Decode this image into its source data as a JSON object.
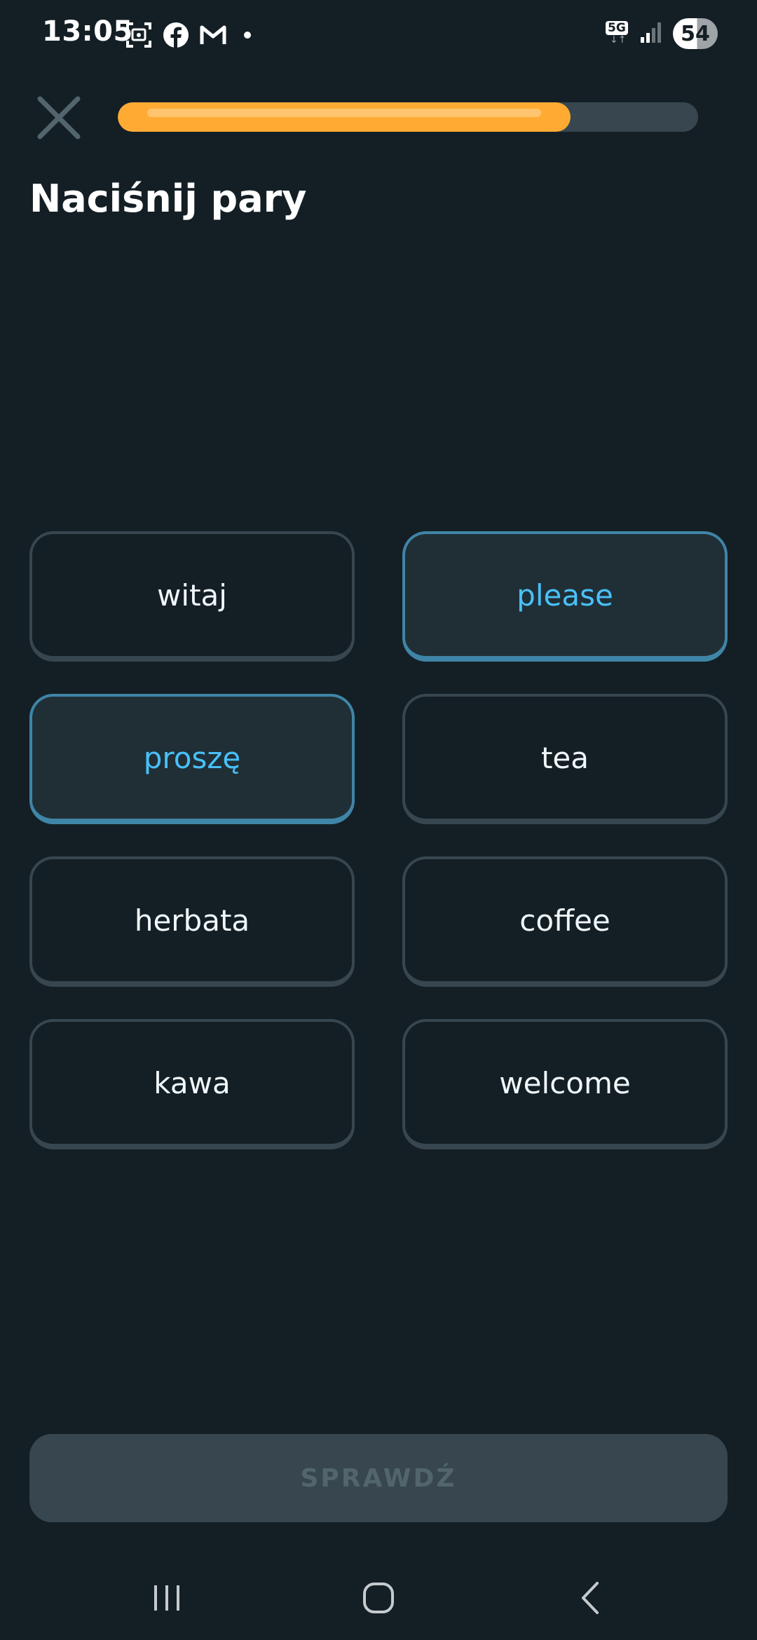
{
  "status_bar": {
    "time": "13:05",
    "network": "5G",
    "battery": "54"
  },
  "header": {
    "progress": 0.78
  },
  "page_title": "Naciśnij pary",
  "tiles": [
    {
      "label": "witaj",
      "selected": false
    },
    {
      "label": "please",
      "selected": true
    },
    {
      "label": "proszę",
      "selected": true
    },
    {
      "label": "tea",
      "selected": false
    },
    {
      "label": "herbata",
      "selected": false
    },
    {
      "label": "coffee",
      "selected": false
    },
    {
      "label": "kawa",
      "selected": false
    },
    {
      "label": "welcome",
      "selected": false
    }
  ],
  "check_button": {
    "label": "SPRAWDŹ"
  },
  "colors": {
    "background": "#141f25",
    "progress_fill": "#ffab33",
    "progress_track": "#37464f",
    "selected_border": "#3f85a7",
    "selected_text": "#49c0f8",
    "tile_border": "#37464f"
  },
  "icons": {
    "close": "close-icon",
    "screenshot": "screenshot-icon",
    "facebook": "facebook-icon",
    "gmail": "gmail-icon",
    "signal": "signal-icon",
    "recents": "recents-icon",
    "home": "home-icon",
    "back": "back-icon"
  }
}
